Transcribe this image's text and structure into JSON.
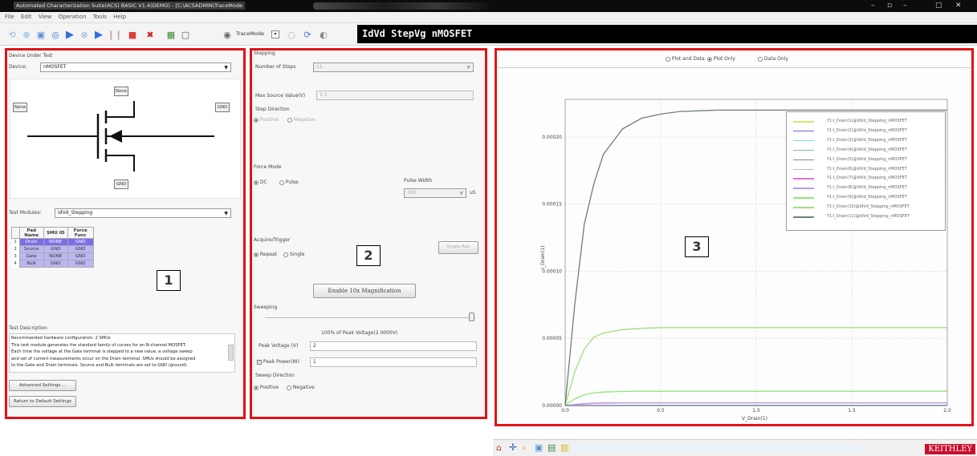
{
  "window": {
    "title": "Automated Characterization Suite(ACS) BASIC V1.4(DEMO) - [C:\\ACSADMIN\\TraceMode"
  },
  "menu": [
    "File",
    "Edit",
    "View",
    "Operation",
    "Tools",
    "Help"
  ],
  "toolbar": {
    "trace_mode_label": "TraceMode",
    "test_name": "IdVd StepVg nMOSFET"
  },
  "panel1": {
    "group_label": "Device Under Test",
    "device_label": "Device:",
    "device_value": "nMOSFET",
    "pads": {
      "top": "None",
      "left": "None",
      "right": "GND",
      "bottom": "GND"
    },
    "test_modules_label": "Test Modules:",
    "test_module_value": "IdVd_Stepping",
    "table_headers": [
      "Pad Name",
      "SMU  ID",
      "Force Func"
    ],
    "rows": [
      {
        "n": "1",
        "pad": "Drain",
        "smu": "NONE",
        "force": "GND"
      },
      {
        "n": "2",
        "pad": "Source",
        "smu": "GND",
        "force": "GND"
      },
      {
        "n": "3",
        "pad": "Gate",
        "smu": "NONE",
        "force": "GND"
      },
      {
        "n": "4",
        "pad": "Bulk",
        "smu": "GND",
        "force": "GND"
      }
    ],
    "number_label": "1",
    "description_label": "Test Description",
    "description_lines": [
      "Recommended hardware configuration: 2 SMUs",
      "This test module generates the standard family of curves for an N-channel MOSFET.",
      "Each time the voltage at the Gate terminal is stepped to a new value, a voltage sweep",
      "and set of current measurements occur on the Drain terminal. SMUs should be assigned",
      "to the Gate and Drain terminals. Source and Bulk terminals are set to GND (ground)."
    ],
    "advanced_btn": "Advanced Settings ...",
    "default_btn": "Return to Default Settings"
  },
  "panel2": {
    "stepping_label": "Stepping",
    "num_steps_label": "Number  of  Steps",
    "num_steps_value": "11",
    "max_source_label": "Max Source Value(V)",
    "max_source_value": "1.5",
    "step_dir_label": "Step Direction",
    "positive": "Positive",
    "negative": "Negative",
    "force_mode_label": "Force Mode",
    "dc": "DC",
    "pulse": "Pulse",
    "pulse_width_label": "Pulse Width",
    "pulse_width_value": "300",
    "pulse_unit": "uS",
    "acquire_label": "Acquire/Trigger",
    "repeat": "Repeat",
    "single": "Single",
    "single_run_btn": "Single Run",
    "number_label": "2",
    "magnify_btn": "Enable 10x Magnification",
    "sweeping_label": "Sweeping",
    "peak_pct_label": "100% of Peak Voltage(2.0000V)",
    "peak_voltage_label": "Peak  Voltage (V)",
    "peak_voltage_value": "2",
    "peak_power_label": "Peak Power(W)",
    "peak_power_value": "1",
    "sweep_dir_label": "Sweep Direction"
  },
  "panel3": {
    "radio_plot_data": "Plot and Data",
    "radio_plot_only": "Plot Only",
    "radio_data_only": "Data Only",
    "number_label": "3",
    "brand": "KEITHLEY"
  },
  "colors": {
    "highlight_box": "#e01419",
    "drain_row": "#7a6fe8",
    "table_row": "#bcb6f2"
  },
  "chart_data": {
    "type": "line",
    "xlabel": "V_Drain(1)",
    "ylabel": "I_Drain(1)",
    "xlim": [
      0,
      2.0
    ],
    "ylim": [
      0,
      0.000228
    ],
    "x_ticks": [
      "0.0",
      "0.5",
      "1.0",
      "1.5",
      "2.0"
    ],
    "y_ticks": [
      "0.00000",
      "0.00005",
      "0.00010",
      "0.00015",
      "0.00020"
    ],
    "legend_position": "top-right",
    "grid": true,
    "x": [
      0,
      0.05,
      0.1,
      0.15,
      0.2,
      0.3,
      0.4,
      0.5,
      0.6,
      0.8,
      1.0,
      1.5,
      2.0
    ],
    "series": [
      {
        "name": "Y1:I_Drain(1)@IdVd_Stepping_nMOSFET",
        "color": "#d9e36b",
        "values": [
          0,
          0,
          0,
          0,
          0,
          0,
          0,
          0,
          0,
          0,
          0,
          0,
          0
        ]
      },
      {
        "name": "Y1:I_Drain(2)@IdVd_Stepping_nMOSFET",
        "color": "#7b5de8",
        "values": [
          0,
          0,
          0,
          0,
          0,
          0,
          0,
          0,
          0,
          0,
          0,
          0,
          0
        ]
      },
      {
        "name": "Y1:I_Drain(3)@IdVd_Stepping_nMOSFET",
        "color": "#7fdde8",
        "values": [
          0,
          0,
          0,
          0,
          0,
          0,
          0,
          0,
          0,
          0,
          0,
          0,
          0
        ]
      },
      {
        "name": "Y1:I_Drain(4)@IdVd_Stepping_nMOSFET",
        "color": "#8cb0c8",
        "values": [
          0,
          0,
          0,
          0,
          0,
          0,
          0,
          0,
          0,
          0,
          0,
          0,
          0
        ]
      },
      {
        "name": "Y1:I_Drain(5)@IdVd_Stepping_nMOSFET",
        "color": "#8c8c8c",
        "values": [
          0,
          0,
          0,
          0,
          0,
          0,
          0,
          0,
          0,
          0,
          0,
          0,
          0
        ]
      },
      {
        "name": "Y1:I_Drain(6)@IdVd_Stepping_nMOSFET",
        "color": "#b0b8d8",
        "values": [
          0,
          0,
          0,
          0,
          0,
          0,
          0,
          0,
          0,
          0,
          0,
          0,
          0
        ]
      },
      {
        "name": "Y1:I_Drain(7)@IdVd_Stepping_nMOSFET",
        "color": "#e070d8",
        "values": [
          0,
          6e-07,
          1.2e-06,
          1.6e-06,
          1.8e-06,
          2e-06,
          2e-06,
          2e-06,
          2e-06,
          2e-06,
          2e-06,
          2e-06,
          2e-06
        ]
      },
      {
        "name": "Y1:I_Drain(8)@IdVd_Stepping_nMOSFET",
        "color": "#b69ee0",
        "values": [
          0,
          8e-07,
          1.4e-06,
          1.8e-06,
          2e-06,
          2e-06,
          2e-06,
          2e-06,
          2e-06,
          2e-06,
          2e-06,
          2e-06,
          2e-06
        ]
      },
      {
        "name": "Y1:I_Drain(9)@IdVd_Stepping_nMOSFET",
        "color": "#8ee878",
        "values": [
          0,
          5e-06,
          8e-06,
          9.5e-06,
          1e-05,
          1.05e-05,
          1.06e-05,
          1.06e-05,
          1.06e-05,
          1.06e-05,
          1.06e-05,
          1.06e-05,
          1.06e-05
        ]
      },
      {
        "name": "Y1:I_Drain(10)@IdVd_Stepping_nMOSFET",
        "color": "#a0de7e",
        "values": [
          0,
          2.5e-05,
          4.2e-05,
          5.1e-05,
          5.4e-05,
          5.65e-05,
          5.75e-05,
          5.8e-05,
          5.8e-05,
          5.8e-05,
          5.8e-05,
          5.8e-05,
          5.8e-05
        ]
      },
      {
        "name": "Y1:I_Drain(11)@IdVd_Stepping_nMOSFET",
        "color": "#6e7e7a",
        "values": [
          0,
          7.5e-05,
          0.000135,
          0.000165,
          0.000187,
          0.000206,
          0.000214,
          0.000217,
          0.000219,
          0.00022,
          0.00022,
          0.00022,
          0.00022
        ]
      }
    ]
  }
}
